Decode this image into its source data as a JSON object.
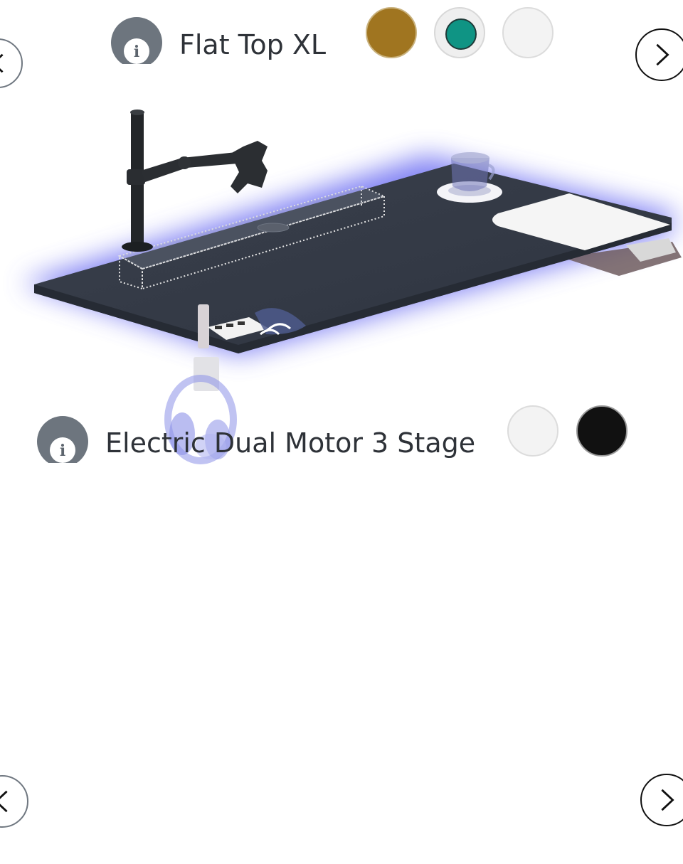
{
  "top_config": {
    "title": "Flat Top XL",
    "info_icon": "info-icon",
    "swatches": [
      {
        "name": "gold-swatch",
        "color": "#a07520"
      },
      {
        "name": "teal-swatch",
        "color": "#0f9484"
      },
      {
        "name": "white-swatch",
        "color": "#f3f3f3"
      }
    ]
  },
  "bottom_config": {
    "title": "Electric Dual Motor 3 Stage",
    "info_icon": "info-icon",
    "swatches": [
      {
        "name": "white-swatch",
        "color": "#f3f3f3"
      },
      {
        "name": "black-swatch",
        "color": "#111111"
      }
    ]
  },
  "nav": {
    "prev_icon": "chevron-left-icon",
    "next_icon": "chevron-right-icon"
  },
  "scene": {
    "desk_color": "#343a46",
    "glow_color": "#5a5cf0"
  }
}
